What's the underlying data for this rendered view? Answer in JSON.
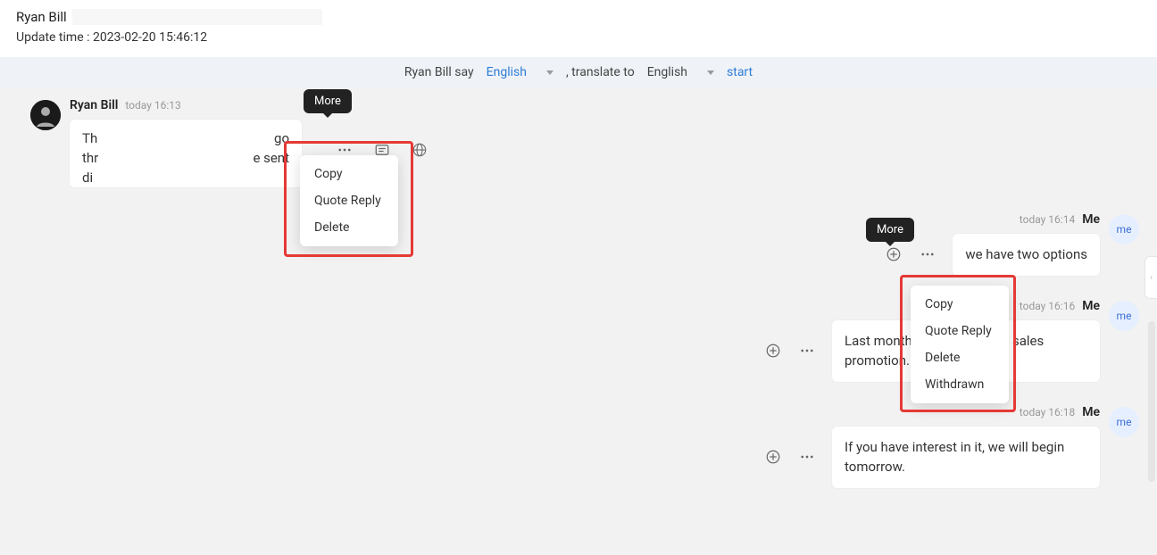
{
  "header": {
    "name": "Ryan Bill",
    "update_prefix": "Update time : ",
    "update_time": "2023-02-20 15:46:12"
  },
  "translate": {
    "prefix": "Ryan Bill say",
    "lang_from": "English",
    "mid": ", translate to",
    "lang_to": "English",
    "start": "start"
  },
  "tooltips": {
    "more": "More"
  },
  "menu_left": [
    "Copy",
    "Quote Reply",
    "Delete"
  ],
  "menu_right": [
    "Copy",
    "Quote Reply",
    "Delete",
    "Withdrawn"
  ],
  "left_msg": {
    "name": "Ryan Bill",
    "time": "today 16:13",
    "frag1": "Th",
    "frag2": "go",
    "frag3": "thr",
    "frag4": "e sent",
    "frag5": "di"
  },
  "right_msgs": [
    {
      "time": "today 16:14",
      "me": "Me",
      "avatar": "me",
      "text": "we have two options"
    },
    {
      "time": "today 16:16",
      "me": "Me",
      "avatar": "me",
      "text": "Last month we                        sales promotion."
    },
    {
      "time": "today 16:18",
      "me": "Me",
      "avatar": "me",
      "text": "If you have interest in it, we will begin tomorrow."
    }
  ]
}
